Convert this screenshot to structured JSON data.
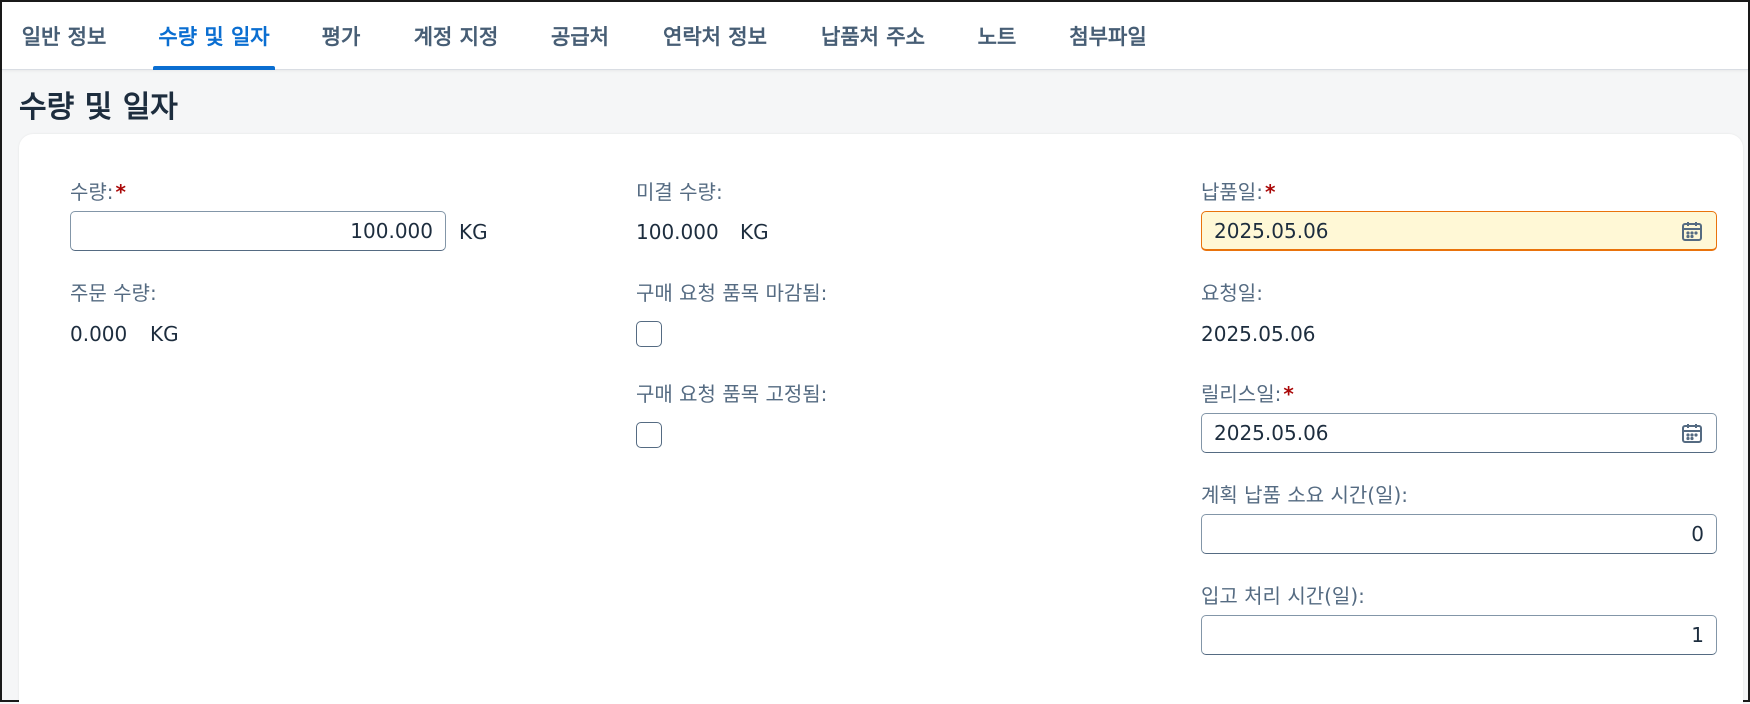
{
  "tabs": [
    {
      "label": "일반 정보",
      "active": false
    },
    {
      "label": "수량 및 일자",
      "active": true
    },
    {
      "label": "평가",
      "active": false
    },
    {
      "label": "계정 지정",
      "active": false
    },
    {
      "label": "공급처",
      "active": false
    },
    {
      "label": "연락처 정보",
      "active": false
    },
    {
      "label": "납품처 주소",
      "active": false
    },
    {
      "label": "노트",
      "active": false
    },
    {
      "label": "첨부파일",
      "active": false
    }
  ],
  "section": {
    "title": "수량 및 일자"
  },
  "required_marker": "*",
  "fields": {
    "quantity": {
      "label": "수량:",
      "value": "100.000",
      "unit": "KG"
    },
    "ordered_quantity": {
      "label": "주문 수량:",
      "value": "0.000",
      "unit": "KG"
    },
    "open_quantity": {
      "label": "미결 수량:",
      "value": "100.000",
      "unit": "KG"
    },
    "pr_item_closed": {
      "label": "구매 요청 품목 마감됨:",
      "checked": false
    },
    "pr_item_fixed": {
      "label": "구매 요청 품목 고정됨:",
      "checked": false
    },
    "delivery_date": {
      "label": "납품일:",
      "value": "2025.05.06"
    },
    "request_date": {
      "label": "요청일:",
      "value": "2025.05.06"
    },
    "release_date": {
      "label": "릴리스일:",
      "value": "2025.05.06"
    },
    "planned_delivery_time": {
      "label": "계획 납품 소요 시간(일):",
      "value": "0"
    },
    "gr_processing_time": {
      "label": "입고 처리 시간(일):",
      "value": "1"
    }
  },
  "colors": {
    "accent": "#0a6ed1",
    "required": "#aa0808",
    "warning_bg": "#fff8d6",
    "warning_border": "#e9730c"
  },
  "icons": {
    "date_picker": "calendar-icon"
  }
}
